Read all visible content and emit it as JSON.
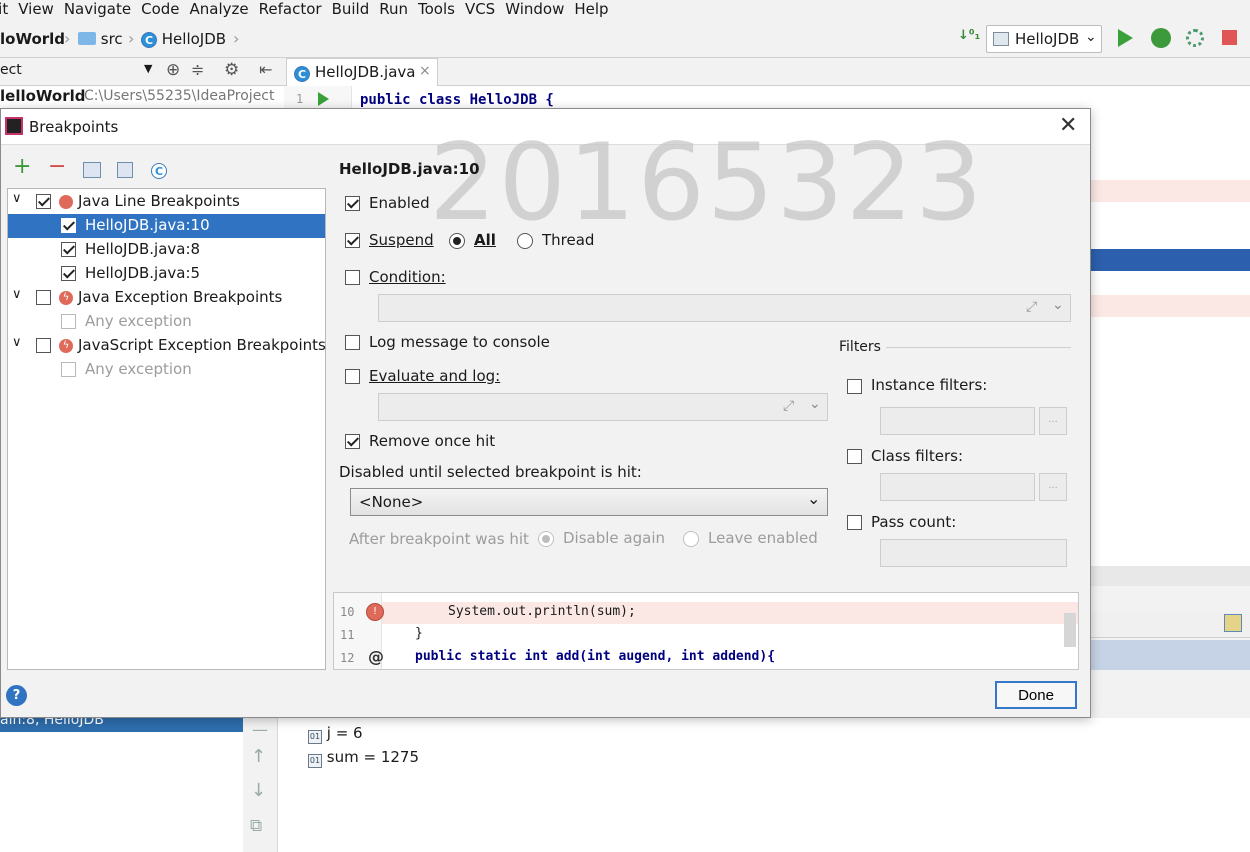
{
  "menu": [
    "lit",
    "View",
    "Navigate",
    "Code",
    "Analyze",
    "Refactor",
    "Build",
    "Run",
    "Tools",
    "VCS",
    "Window",
    "Help"
  ],
  "nav": {
    "project": "loWorld",
    "src": "src",
    "class": "HelloJDB",
    "run_config": "HelloJDB"
  },
  "project_panel": {
    "header": "ect",
    "root_name": "lelloWorld",
    "root_path": "C:\\Users\\55235\\IdeaProject"
  },
  "editor": {
    "tab": "HelloJDB.java",
    "line1_no": "1",
    "line1_code": "public class HelloJDB {"
  },
  "dialog": {
    "title": "Breakpoints",
    "heading": "HelloJDB.java:10",
    "watermark": "20165323",
    "tree": {
      "java_line": "Java Line Breakpoints",
      "bp1": "HelloJDB.java:10",
      "bp2": "HelloJDB.java:8",
      "bp3": "HelloJDB.java:5",
      "java_exc": "Java Exception Breakpoints",
      "any1": "Any exception",
      "js_exc": "JavaScript Exception Breakpoints",
      "any2": "Any exception"
    },
    "enabled": "Enabled",
    "suspend": "Suspend",
    "all": "All",
    "thread": "Thread",
    "condition": "Condition:",
    "log_message": "Log message to console",
    "evaluate": "Evaluate and log:",
    "remove_once": "Remove once hit",
    "disabled_until": "Disabled until selected breakpoint is hit:",
    "none_option": "<None>",
    "after_hit": "After breakpoint was hit",
    "disable_again": "Disable again",
    "leave_enabled": "Leave enabled",
    "filters": "Filters",
    "instance_filters": "Instance filters:",
    "class_filters": "Class filters:",
    "pass_count": "Pass count:",
    "ellipsis": "...",
    "done": "Done",
    "help": "?",
    "code": {
      "l10_no": "10",
      "l10": "System.out.println(sum);",
      "l11_no": "11",
      "l11": "}",
      "l12_no": "12",
      "l12": "public static int add(int augend, int addend){"
    }
  },
  "debug": {
    "frame": "ain:8, HelloJDB",
    "var_j": "j = 6",
    "var_sum": "sum = 1275"
  }
}
